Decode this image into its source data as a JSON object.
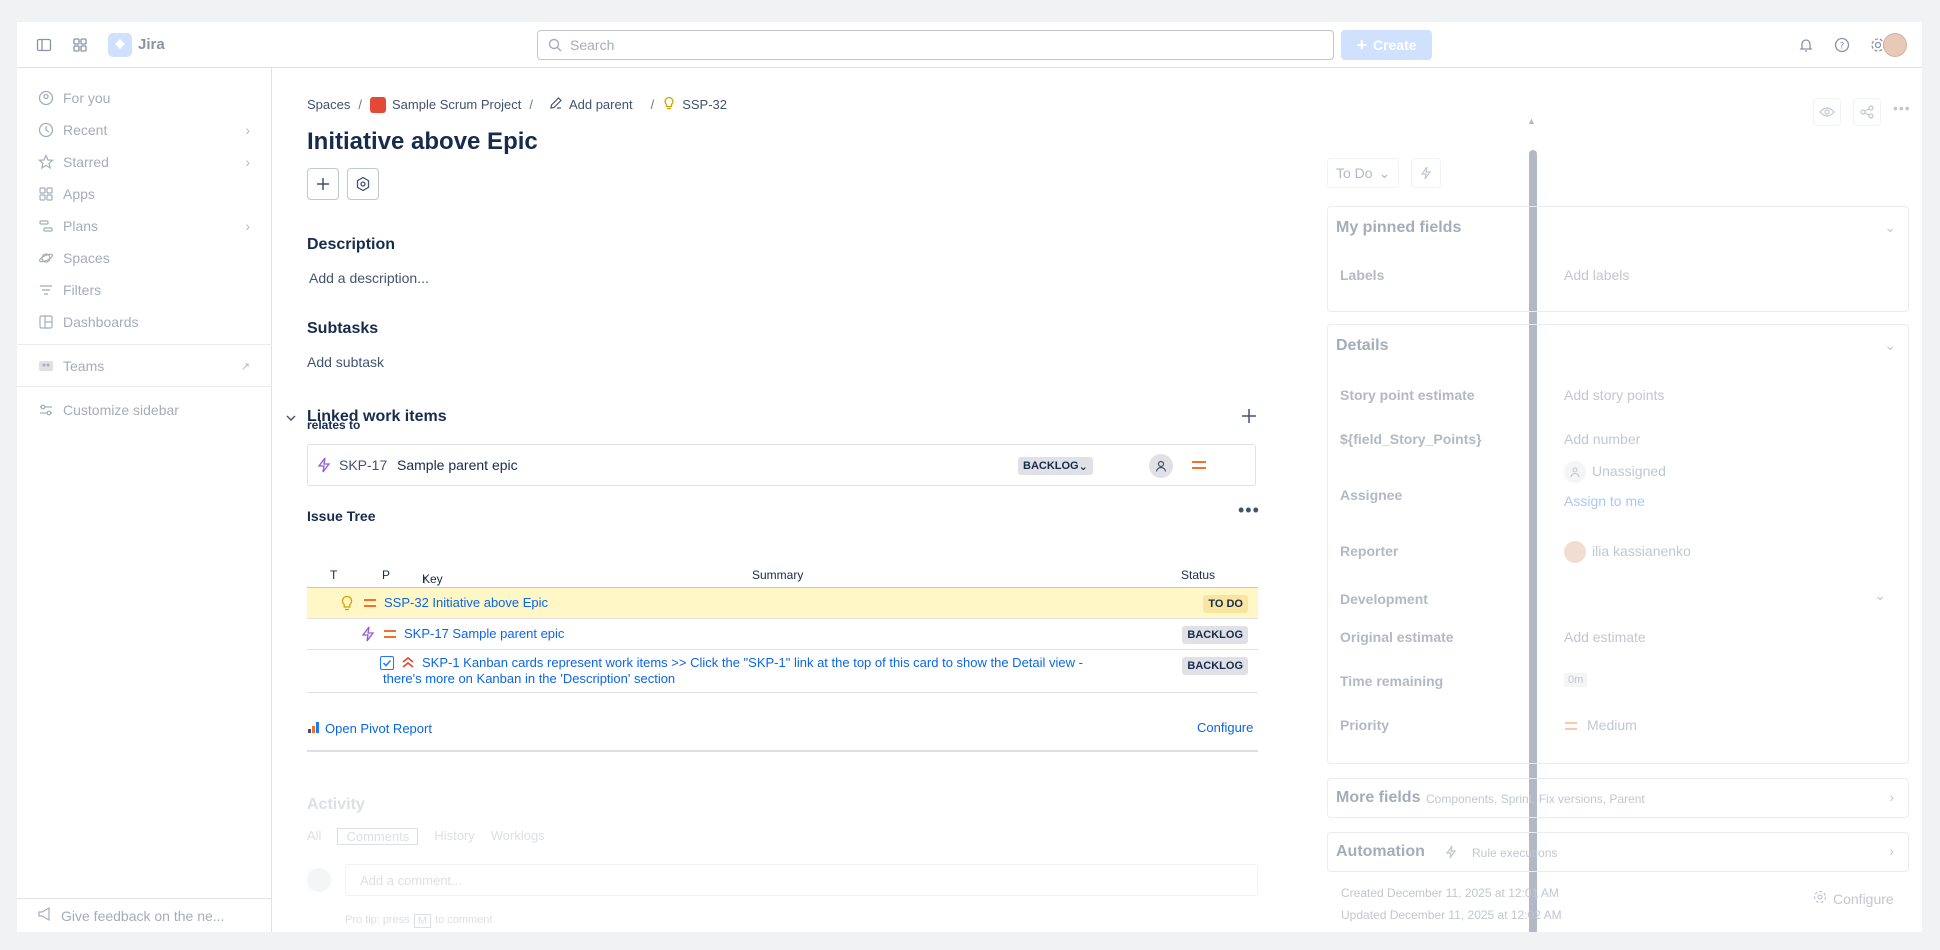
{
  "app": {
    "name": "Jira"
  },
  "topbar": {
    "search_placeholder": "Search",
    "create_label": "Create"
  },
  "sidebar": {
    "items": [
      {
        "label": "For you"
      },
      {
        "label": "Recent"
      },
      {
        "label": "Starred"
      },
      {
        "label": "Apps"
      },
      {
        "label": "Plans"
      },
      {
        "label": "Spaces"
      },
      {
        "label": "Filters"
      },
      {
        "label": "Dashboards"
      },
      {
        "label": "Teams"
      },
      {
        "label": "Customize sidebar"
      }
    ],
    "feedback": "Give feedback on the ne..."
  },
  "breadcrumbs": {
    "spaces": "Spaces",
    "project": "Sample Scrum Project",
    "add_parent": "Add parent",
    "issue_key": "SSP-32"
  },
  "issue": {
    "title": "Initiative above Epic",
    "description_heading": "Description",
    "description_placeholder": "Add a description...",
    "subtasks_heading": "Subtasks",
    "add_subtask": "Add subtask",
    "linked_heading": "Linked work items",
    "relates_to": "relates to",
    "linked": {
      "key": "SKP-17",
      "summary": "Sample parent epic",
      "status": "BACKLOG"
    }
  },
  "issue_tree": {
    "heading": "Issue Tree",
    "columns": {
      "t": "T",
      "p": "P",
      "key": "Key",
      "summary": "Summary",
      "status": "Status"
    },
    "rows": [
      {
        "text": "SSP-32 Initiative above Epic",
        "status": "TO DO"
      },
      {
        "text": "SKP-17 Sample parent epic",
        "status": "BACKLOG"
      },
      {
        "text": "SKP-1 Kanban cards represent work items >> Click the \"SKP-1\" link at the top of this card to show the Detail view -",
        "text2": "there's more on Kanban in the 'Description' section",
        "status": "BACKLOG"
      }
    ],
    "open_pivot": "Open Pivot Report",
    "configure": "Configure"
  },
  "activity": {
    "heading": "Activity",
    "tabs": [
      "All",
      "Comments",
      "History",
      "Worklogs"
    ],
    "comment_placeholder": "Add a comment...",
    "pro_tip": "Pro tip: press",
    "pro_key": "M",
    "pro_tip_end": "to comment"
  },
  "right_panel": {
    "status": "To Do",
    "pinned": {
      "title": "My pinned fields",
      "labels_label": "Labels",
      "labels_value": "Add labels"
    },
    "details": {
      "title": "Details",
      "story_points_label": "Story point estimate",
      "story_points_value": "Add story points",
      "field_sp_label": "${field_Story_Points}",
      "field_sp_value": "Add number",
      "assignee_label": "Assignee",
      "assignee_value": "Unassigned",
      "assign_to_me": "Assign to me",
      "reporter_label": "Reporter",
      "reporter_value": "ilia kassianenko",
      "development_label": "Development",
      "orig_est_label": "Original estimate",
      "orig_est_value": "Add estimate",
      "time_rem_label": "Time remaining",
      "time_rem_value": "0m",
      "priority_label": "Priority",
      "priority_value": "Medium"
    },
    "more_fields": {
      "title": "More fields",
      "sub": "Components, Sprint, Fix versions, Parent"
    },
    "automation": {
      "title": "Automation",
      "sub": "Rule executions"
    },
    "created": "Created December 11, 2025 at 12:01 AM",
    "updated": "Updated December 11, 2025 at 12:02 AM",
    "configure": "Configure"
  }
}
